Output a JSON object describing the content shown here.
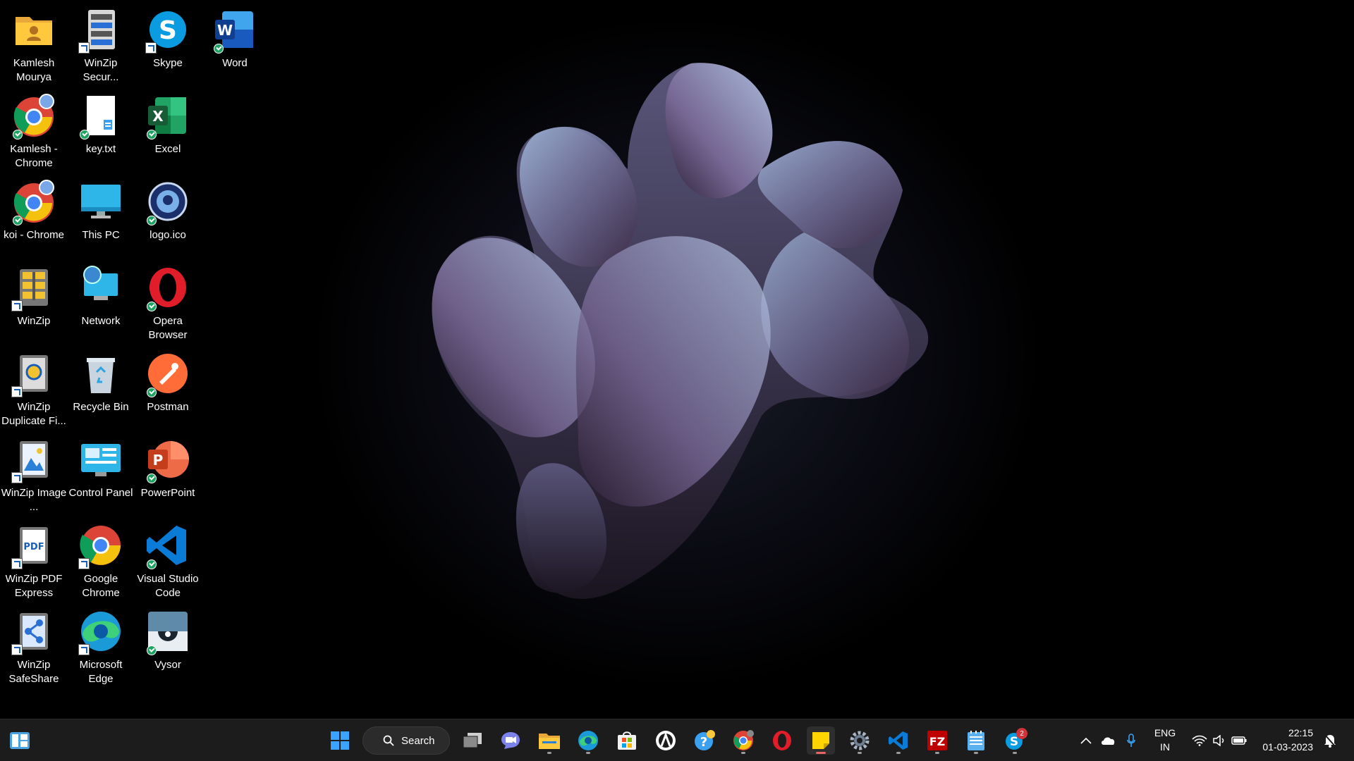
{
  "desktop": {
    "icons": [
      {
        "label": "Kamlesh Mourya",
        "icon": "folder-user-icon"
      },
      {
        "label": "WinZip Secur...",
        "icon": "winzip-secure-icon"
      },
      {
        "label": "Skype",
        "icon": "skype-icon"
      },
      {
        "label": "Word",
        "icon": "word-icon"
      },
      {
        "label": "Kamlesh - Chrome",
        "icon": "chrome-profile-icon"
      },
      {
        "label": "key.txt",
        "icon": "text-file-icon"
      },
      {
        "label": "Excel",
        "icon": "excel-icon"
      },
      {
        "label": "koi - Chrome",
        "icon": "chrome-profile-icon"
      },
      {
        "label": "This PC",
        "icon": "this-pc-icon"
      },
      {
        "label": "logo.ico",
        "icon": "logo-image-icon"
      },
      {
        "label": "WinZip",
        "icon": "winzip-icon"
      },
      {
        "label": "Network",
        "icon": "network-icon"
      },
      {
        "label": "Opera Browser",
        "icon": "opera-icon"
      },
      {
        "label": "WinZip Duplicate Fi...",
        "icon": "winzip-duplicate-icon"
      },
      {
        "label": "Recycle Bin",
        "icon": "recycle-bin-icon"
      },
      {
        "label": "Postman",
        "icon": "postman-icon"
      },
      {
        "label": "WinZip Image ...",
        "icon": "winzip-image-icon"
      },
      {
        "label": "Control Panel",
        "icon": "control-panel-icon"
      },
      {
        "label": "PowerPoint",
        "icon": "powerpoint-icon"
      },
      {
        "label": "WinZip PDF Express",
        "icon": "winzip-pdf-icon"
      },
      {
        "label": "Google Chrome",
        "icon": "chrome-icon"
      },
      {
        "label": "Visual Studio Code",
        "icon": "vscode-icon"
      },
      {
        "label": "WinZip SafeShare",
        "icon": "winzip-safeshare-icon"
      },
      {
        "label": "Microsoft Edge",
        "icon": "edge-icon"
      },
      {
        "label": "Vysor",
        "icon": "vysor-icon"
      }
    ]
  },
  "taskbar": {
    "search_label": "Search",
    "apps": [
      "widgets-icon",
      "start-icon",
      "task-view-icon",
      "teams-chat-icon",
      "file-explorer-icon",
      "edge-icon",
      "store-icon",
      "app-icon",
      "get-help-icon",
      "chrome-icon",
      "opera-icon",
      "sticky-notes-icon",
      "settings-icon",
      "vscode-icon",
      "filezilla-icon",
      "notepad-icon",
      "skype-icon"
    ],
    "skype_badge": "2",
    "tray": {
      "language_line1": "ENG",
      "language_line2": "IN",
      "time": "22:15",
      "date": "01-03-2023"
    }
  },
  "colors": {
    "taskbar_bg": "#1c1c1c",
    "accent": "#0078d4"
  }
}
